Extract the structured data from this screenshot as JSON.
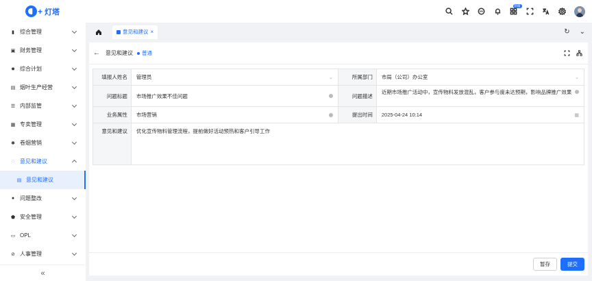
{
  "app": {
    "name": "灯塔"
  },
  "header": {
    "icons": [
      "search-icon",
      "star-icon",
      "message-icon",
      "bell-icon",
      "apps-icon",
      "fullscreen-icon",
      "translate-icon",
      "settings-icon"
    ],
    "new_badge": "新版"
  },
  "sidebar": {
    "items": [
      {
        "label": "综合管理",
        "icon": "doc-icon"
      },
      {
        "label": "财务管理",
        "icon": "wallet-icon"
      },
      {
        "label": "综合计划",
        "icon": "sun-icon"
      },
      {
        "label": "烟叶生产经营",
        "icon": "book-icon"
      },
      {
        "label": "内部监管",
        "icon": "list-icon"
      },
      {
        "label": "专卖管理",
        "icon": "calendar-icon"
      },
      {
        "label": "卷烟营销",
        "icon": "gear-icon"
      },
      {
        "label": "意见和建议",
        "icon": "chat-icon",
        "expanded": true
      },
      {
        "label": "问题整改",
        "icon": "user-icon"
      },
      {
        "label": "安全管理",
        "icon": "shield-icon"
      },
      {
        "label": "OPL",
        "icon": "file-icon"
      },
      {
        "label": "人事管理",
        "icon": "link-icon"
      }
    ],
    "sub_item": "意见和建议",
    "collapse": "«"
  },
  "tabs": {
    "active": "意见和建议",
    "close": "×"
  },
  "page": {
    "back": "←",
    "title": "意见和建议",
    "status": "普通"
  },
  "form": {
    "reporter_label": "填报人姓名",
    "reporter_value": "管理员",
    "dept_label": "所属部门",
    "dept_value": "市局（公司）办公室",
    "issue_title_label": "问题标题",
    "issue_title_value": "市场推广效果不佳问题",
    "issue_desc_label": "问题描述",
    "issue_desc_value": "近期市场推广活动中，宣传物料发放混乱，客户参与度未达预期，影响品牌推广效果",
    "business_label": "业务属性",
    "business_value": "市场营销",
    "submit_time_label": "提出时间",
    "submit_time_value": "2025-04-24 10:14",
    "suggestion_label": "意见和建议",
    "suggestion_value": "优化宣传物料管理流程，提前做好活动预热和客户引导工作"
  },
  "footer": {
    "save_label": "暂存",
    "submit_label": "提交"
  },
  "colors": {
    "accent": "#1f6fff"
  }
}
